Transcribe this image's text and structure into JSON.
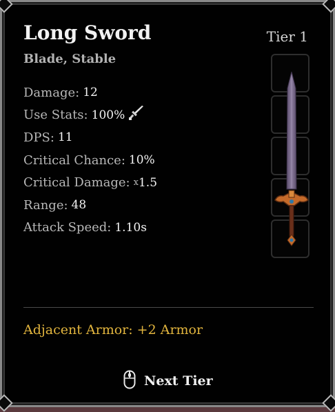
{
  "item": {
    "name": "Long Sword",
    "tier": "Tier 1",
    "tags": "Blade, Stable"
  },
  "stats": [
    {
      "label": "Damage:",
      "value": "12"
    },
    {
      "label": "Use Stats:",
      "value": "100%",
      "icon": "sword-icon"
    },
    {
      "label": "DPS:",
      "value": "11"
    },
    {
      "label": "Critical Chance:",
      "value": "10%"
    },
    {
      "label": "Critical Damage:",
      "prefix": "x",
      "value": "1.5"
    },
    {
      "label": "Range:",
      "value": "48"
    },
    {
      "label": "Attack Speed:",
      "value": "1.10s"
    }
  ],
  "bonus": {
    "adjacent": "Adjacent Armor: +2 Armor"
  },
  "footer": {
    "next_tier_label": "Next Tier",
    "icon": "mouse-icon"
  },
  "colors": {
    "bonus_text": "#e2b53e",
    "blade": "#7b6a8e",
    "guard": "#c46a2a"
  }
}
